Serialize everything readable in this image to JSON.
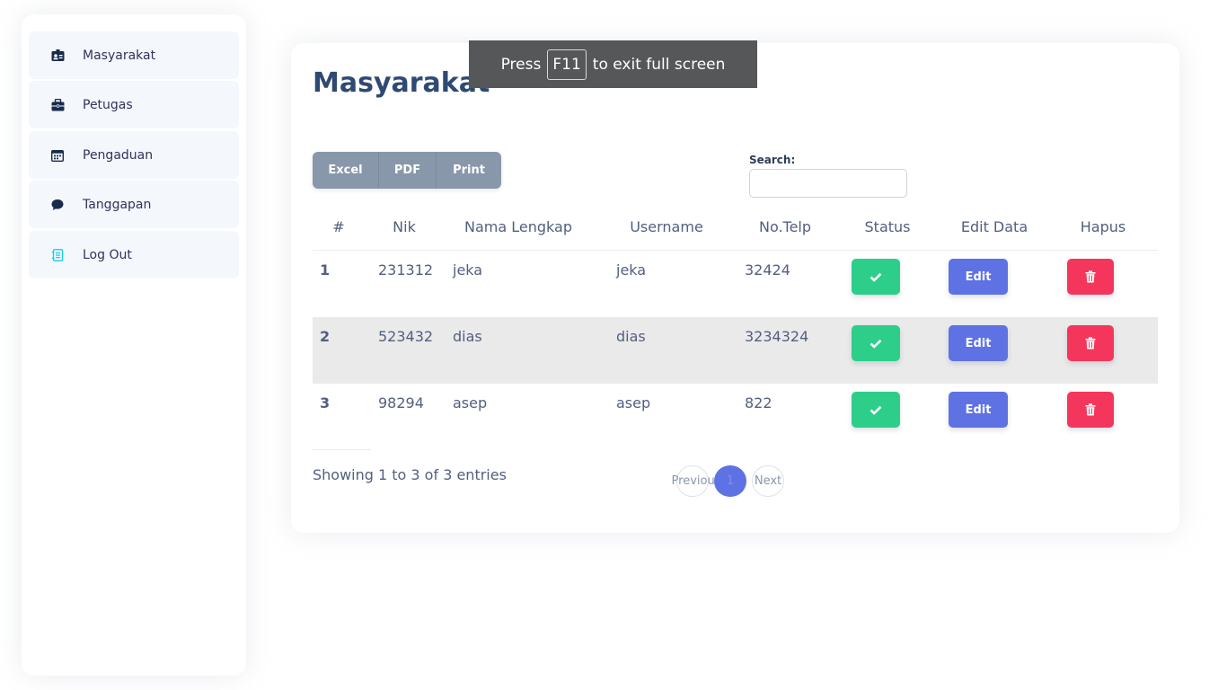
{
  "sidebar": {
    "items": [
      {
        "label": "Masyarakat",
        "icon": "id-card-icon"
      },
      {
        "label": "Petugas",
        "icon": "briefcase-icon"
      },
      {
        "label": "Pengaduan",
        "icon": "calendar-icon"
      },
      {
        "label": "Tanggapan",
        "icon": "chat-bubble-icon"
      },
      {
        "label": "Log Out",
        "icon": "logout-icon"
      }
    ]
  },
  "main": {
    "title": "Masyarakat",
    "export_buttons": [
      "Excel",
      "PDF",
      "Print"
    ],
    "search": {
      "label": "Search:",
      "value": "",
      "placeholder": ""
    },
    "table": {
      "columns": [
        "#",
        "Nik",
        "Nama Lengkap",
        "Username",
        "No.Telp",
        "Status",
        "Edit Data",
        "Hapus"
      ],
      "rows": [
        {
          "no": "1",
          "nik": "231312",
          "nama": "jeka",
          "username": "jeka",
          "telp": "32424",
          "edit_label": "Edit"
        },
        {
          "no": "2",
          "nik": "523432",
          "nama": "dias",
          "username": "dias",
          "telp": "3234324",
          "edit_label": "Edit"
        },
        {
          "no": "3",
          "nik": "98294",
          "nama": "asep",
          "username": "asep",
          "telp": "822",
          "edit_label": "Edit"
        }
      ]
    },
    "info": "Showing 1 to 3 of 3 entries",
    "pagination": {
      "previous": "Previous",
      "current": "1",
      "next": "Next"
    }
  },
  "toast": {
    "prefix": "Press",
    "key": "F11",
    "suffix": "to exit full screen"
  },
  "colors": {
    "status_button": "#2dce89",
    "edit_button": "#5e72e4",
    "delete_button": "#f5365c",
    "export_button": "#8898aa",
    "title": "#2e4a73"
  }
}
